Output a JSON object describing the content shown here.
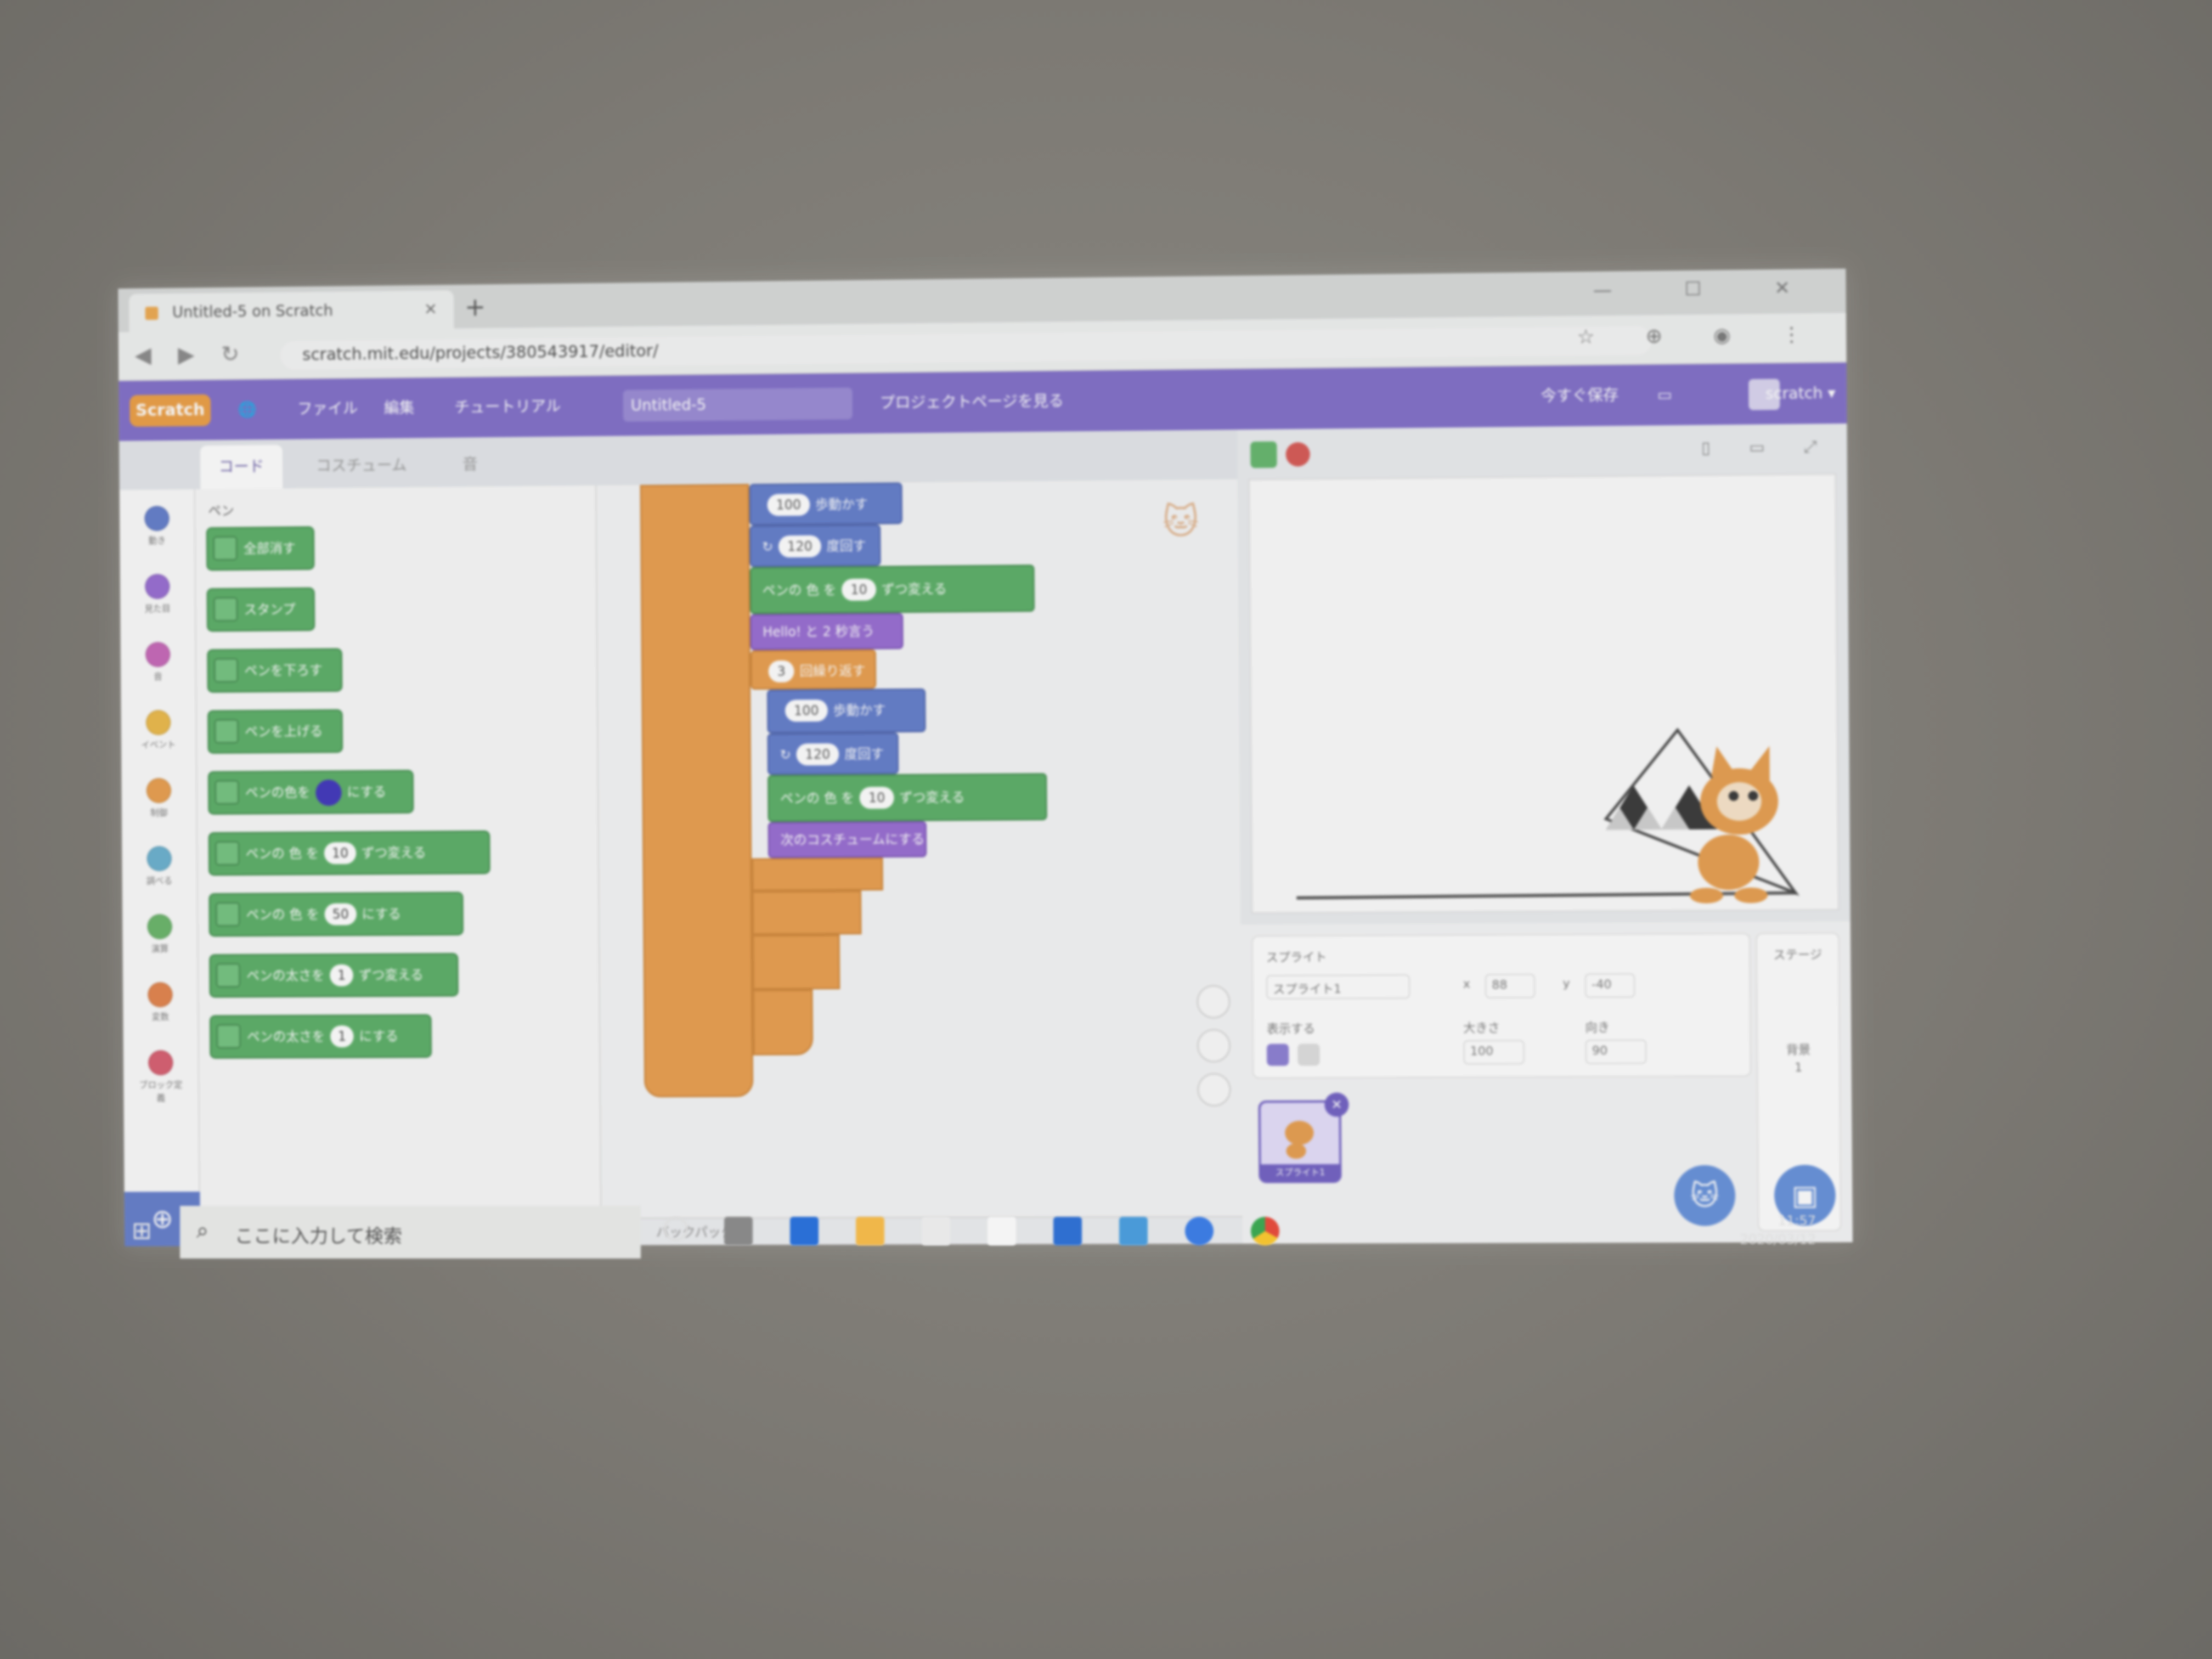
{
  "browser": {
    "tab_title": "Untitled-5 on Scratch",
    "tab_close": "×",
    "new_tab": "+",
    "url": "scratch.mit.edu/projects/380543917/editor/",
    "back_icon": "◀",
    "forward_icon": "▶",
    "reload_icon": "↻",
    "window_controls": "— ☐ ✕"
  },
  "menubar": {
    "logo": "Scratch",
    "globe_icon": "🌐",
    "file": "ファイル",
    "edit": "編集",
    "tutorials": "チュートリアル",
    "project_title": "Untitled-5",
    "share_notice": "プロジェクトページを見る",
    "save_now": "今すぐ保存",
    "username": "scratch ▾"
  },
  "editor_tabs": {
    "code": "コード",
    "costumes": "コスチューム",
    "sounds": "音"
  },
  "categories": [
    {
      "label": "動き",
      "color": "#5a7ad8"
    },
    {
      "label": "見た目",
      "color": "#9a66e0"
    },
    {
      "label": "音",
      "color": "#d25fc0"
    },
    {
      "label": "イベント",
      "color": "#f3b731"
    },
    {
      "label": "制御",
      "color": "#f49a39"
    },
    {
      "label": "調べる",
      "color": "#5cb1d6"
    },
    {
      "label": "演算",
      "color": "#5cb75c"
    },
    {
      "label": "変数",
      "color": "#f07d3a"
    },
    {
      "label": "ブロック定義",
      "color": "#e8556b"
    }
  ],
  "palette": {
    "heading": "ペン",
    "blocks": [
      {
        "label": "全部消す"
      },
      {
        "label": "スタンプ"
      },
      {
        "label": "ペンを下ろす"
      },
      {
        "label": "ペンを上げる"
      },
      {
        "label": "ペンの色を",
        "suffix": "にする"
      },
      {
        "label": "ペンの 色 を",
        "value": "10",
        "suffix": "ずつ変える"
      },
      {
        "label": "ペンの 色 を",
        "value": "50",
        "suffix": "にする"
      },
      {
        "label": "ペンの太さを",
        "value": "1",
        "suffix": "ずつ変える"
      },
      {
        "label": "ペンの太さを",
        "value": "1",
        "suffix": "にする"
      }
    ]
  },
  "script": {
    "move1": {
      "value": "100",
      "label": "歩動かす"
    },
    "turn1": {
      "prefix": "↻",
      "value": "120",
      "label": "度回す"
    },
    "pen1": {
      "label": "ペンの 色 を",
      "value": "10",
      "suffix": "ずつ変える"
    },
    "looks1": {
      "label": "Hello! と 2 秒言う"
    },
    "repeat": {
      "value": "3",
      "label": "回繰り返す"
    },
    "move2": {
      "value": "100",
      "label": "歩動かす"
    },
    "turn2": {
      "prefix": "↻",
      "value": "120",
      "label": "度回す"
    },
    "pen2": {
      "label": "ペンの 色 を",
      "value": "10",
      "suffix": "ずつ変える"
    },
    "looks2": {
      "label": "次のコスチュームにする"
    }
  },
  "backpack": {
    "label": "バックパック"
  },
  "stage_controls": {
    "modes": "▯ ▭ ⤢"
  },
  "sprite_info": {
    "sprite_label": "スプライト",
    "sprite_name": "スプライト1",
    "x_label": "x",
    "x_value": "88",
    "y_label": "y",
    "y_value": "-40",
    "show_label": "表示する",
    "size_label": "大きさ",
    "size_value": "100",
    "direction_label": "向き",
    "direction_value": "90",
    "stage_label": "ステージ",
    "backdrops_label": "背景",
    "backdrops_count": "1"
  },
  "sprite_thumb": {
    "label": "スプライト1"
  },
  "taskbar": {
    "search_placeholder": "ここに入力して検索",
    "time": "11:57",
    "date": "2020/03/12"
  },
  "colors": {
    "scratch_purple": "#7f69d6",
    "control_orange": "#f49a39",
    "pen_green": "#4cb15a",
    "motion_blue": "#5a7ad8",
    "looks_purple": "#9a66e0"
  }
}
